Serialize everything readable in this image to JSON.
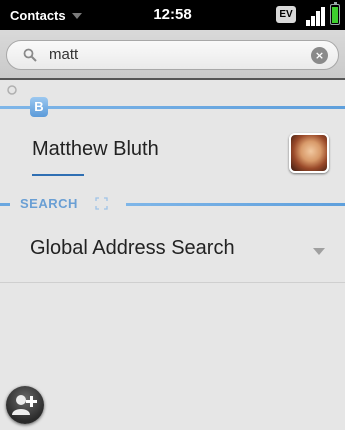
{
  "status_bar": {
    "app_name": "Contacts",
    "time": "12:58",
    "network": "EV",
    "battery_color": "#3dcf2e"
  },
  "search": {
    "value": "matt",
    "icon": "search-icon",
    "clear_icon": "clear-icon"
  },
  "results": {
    "group_letter": "B",
    "contacts": [
      {
        "name": "Matthew Bluth",
        "avatar": "contact-photo"
      }
    ]
  },
  "search_section": {
    "label": "SEARCH",
    "item_label": "Global Address Search",
    "item_icon": "chevron-down-icon"
  },
  "colors": {
    "accent": "#5e9fdc",
    "divider_text": "#6a9fd4"
  },
  "actions": {
    "add_contact_icon": "add-contact-icon"
  }
}
